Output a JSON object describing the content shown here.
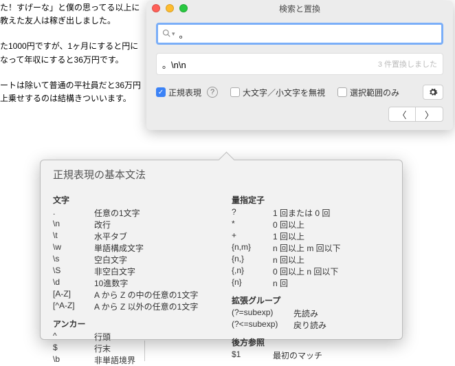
{
  "bg": {
    "p1": "た！すげーな」と僕の思ってる以上に教えた友人は稼ぎ出しました。",
    "p2": "た1000円ですが、1ヶ月にすると円になって年収にすると36万円です。",
    "p3": "ートは除いて普通の平社員だと36万円上乗せするのは結構きついいます。"
  },
  "dialog": {
    "title": "検索と置換",
    "search_value": "。",
    "replace_value": "。\\n\\n",
    "status": "3 件置換しました",
    "regex": "正規表現",
    "ignorecase": "大文字／小文字を無視",
    "selection": "選択範囲のみ"
  },
  "popover": {
    "title": "正規表現の基本文法",
    "chars_h": "文字",
    "chars": [
      [
        ".",
        "任意の1文字"
      ],
      [
        "\\n",
        "改行"
      ],
      [
        "\\t",
        "水平タブ"
      ],
      [
        "\\w",
        "単語構成文字"
      ],
      [
        "\\s",
        "空白文字"
      ],
      [
        "\\S",
        "非空白文字"
      ],
      [
        "\\d",
        "10進数字"
      ],
      [
        "[A-Z]",
        "A から Z の中の任意の1文字"
      ],
      [
        "[^A-Z]",
        "A から Z 以外の任意の1文字"
      ]
    ],
    "anchor_h": "アンカー",
    "anchors": [
      [
        "^",
        "行頭"
      ],
      [
        "$",
        "行末"
      ],
      [
        "\\b",
        "非単語境界"
      ]
    ],
    "quant_h": "量指定子",
    "quants": [
      [
        "?",
        "1 回または 0 回"
      ],
      [
        "*",
        "0 回以上"
      ],
      [
        "+",
        "1 回以上"
      ],
      [
        "{n,m}",
        "n 回以上 m 回以下"
      ],
      [
        "{n,}",
        "n 回以上"
      ],
      [
        "{,n}",
        "0 回以上 n 回以下"
      ],
      [
        "{n}",
        "n 回"
      ]
    ],
    "ext_h": "拡張グループ",
    "exts": [
      [
        "(?=subexp)",
        "先読み"
      ],
      [
        "(?<=subexp)",
        "戻り読み"
      ]
    ],
    "back_h": "後方参照",
    "backs": [
      [
        "$1",
        "最初のマッチ"
      ]
    ]
  }
}
